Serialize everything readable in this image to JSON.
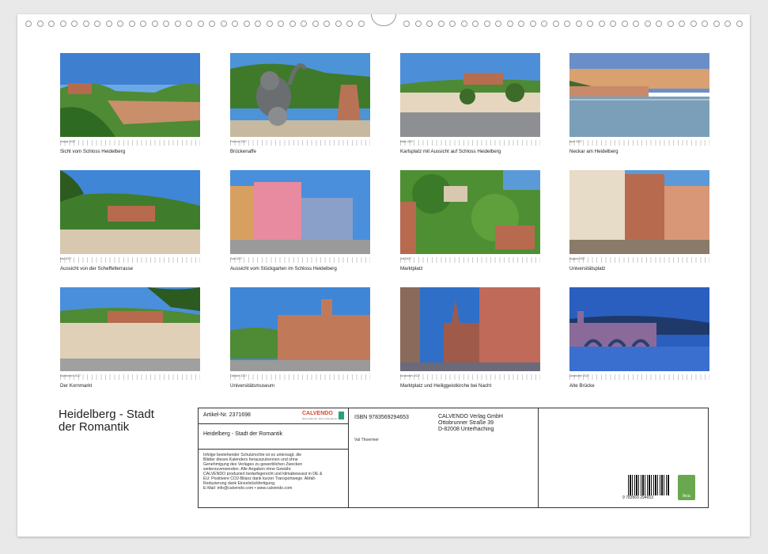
{
  "months": [
    {
      "name": "Januar 2027",
      "caption": "Sicht vom Schloss Heidelberg"
    },
    {
      "name": "Februar 2027",
      "caption": "Brückenaffe"
    },
    {
      "name": "März 2027",
      "caption": "Karlsplatz mit Aussicht auf Schloss Heidelberg"
    },
    {
      "name": "April 2027",
      "caption": "Neckar am Heidelberg"
    },
    {
      "name": "Mai 2027",
      "caption": "Aussicht von der Scheffelterrasse"
    },
    {
      "name": "Juni 2027",
      "caption": "Aussicht vom Stückgarten im Schloss Heidelberg"
    },
    {
      "name": "Juli 2027",
      "caption": "Marktplatz"
    },
    {
      "name": "August 2027",
      "caption": "Universitätsplatz"
    },
    {
      "name": "September 2027",
      "caption": "Der Kornmarkt"
    },
    {
      "name": "Oktober 2027",
      "caption": "Universitätsmuseum"
    },
    {
      "name": "November 2027",
      "caption": "Marktplatz und Heiliggeistkirche bei Nacht"
    },
    {
      "name": "Dezember 2027",
      "caption": "Alte Brücke"
    }
  ],
  "title_line1": "Heidelberg - Stadt",
  "title_line2": "der Romantik",
  "info": {
    "article": "Artikel-Nr. 2371698",
    "logo_text": "CALVENDO",
    "logo_sub": "Mein Kalender. Mein Kalendarium",
    "subtitle": "Heidelberg - Stadt der Romantik",
    "legal": [
      "Infolge bestehender Schutzrechte ist es untersagt, die",
      "Blätter dieses Kalenders herauszutrennen und ohne",
      "Genehmigung des Verlages zu gewerblichen Zwecken",
      "weiterzuverwenden. Alle Angaben ohne Gewähr.",
      "CALVENDO produziert bedarfsgerecht und klimabewusst in DE &",
      "EU: Positivere CO2-Bilanz dank kurzer Transportwege. Abfall-",
      "Reduzierung dank Einzelstückfertigung.",
      "E-Mail: info@calvendo.com • www.calvendo.com"
    ],
    "isbn": "ISBN 9783569294653",
    "author": "Val Thoermer",
    "publisher1": "CALVENDO Verlag GmbH",
    "publisher2": "Ottobrunner Straße 39",
    "publisher3": "D-82008 Unterhaching",
    "barcode_number": "9 783569 294653",
    "feca_label": "feca"
  },
  "colors": {
    "sky": "#3f86d6",
    "green": "#4f8a34",
    "stone": "#b86a4f"
  }
}
